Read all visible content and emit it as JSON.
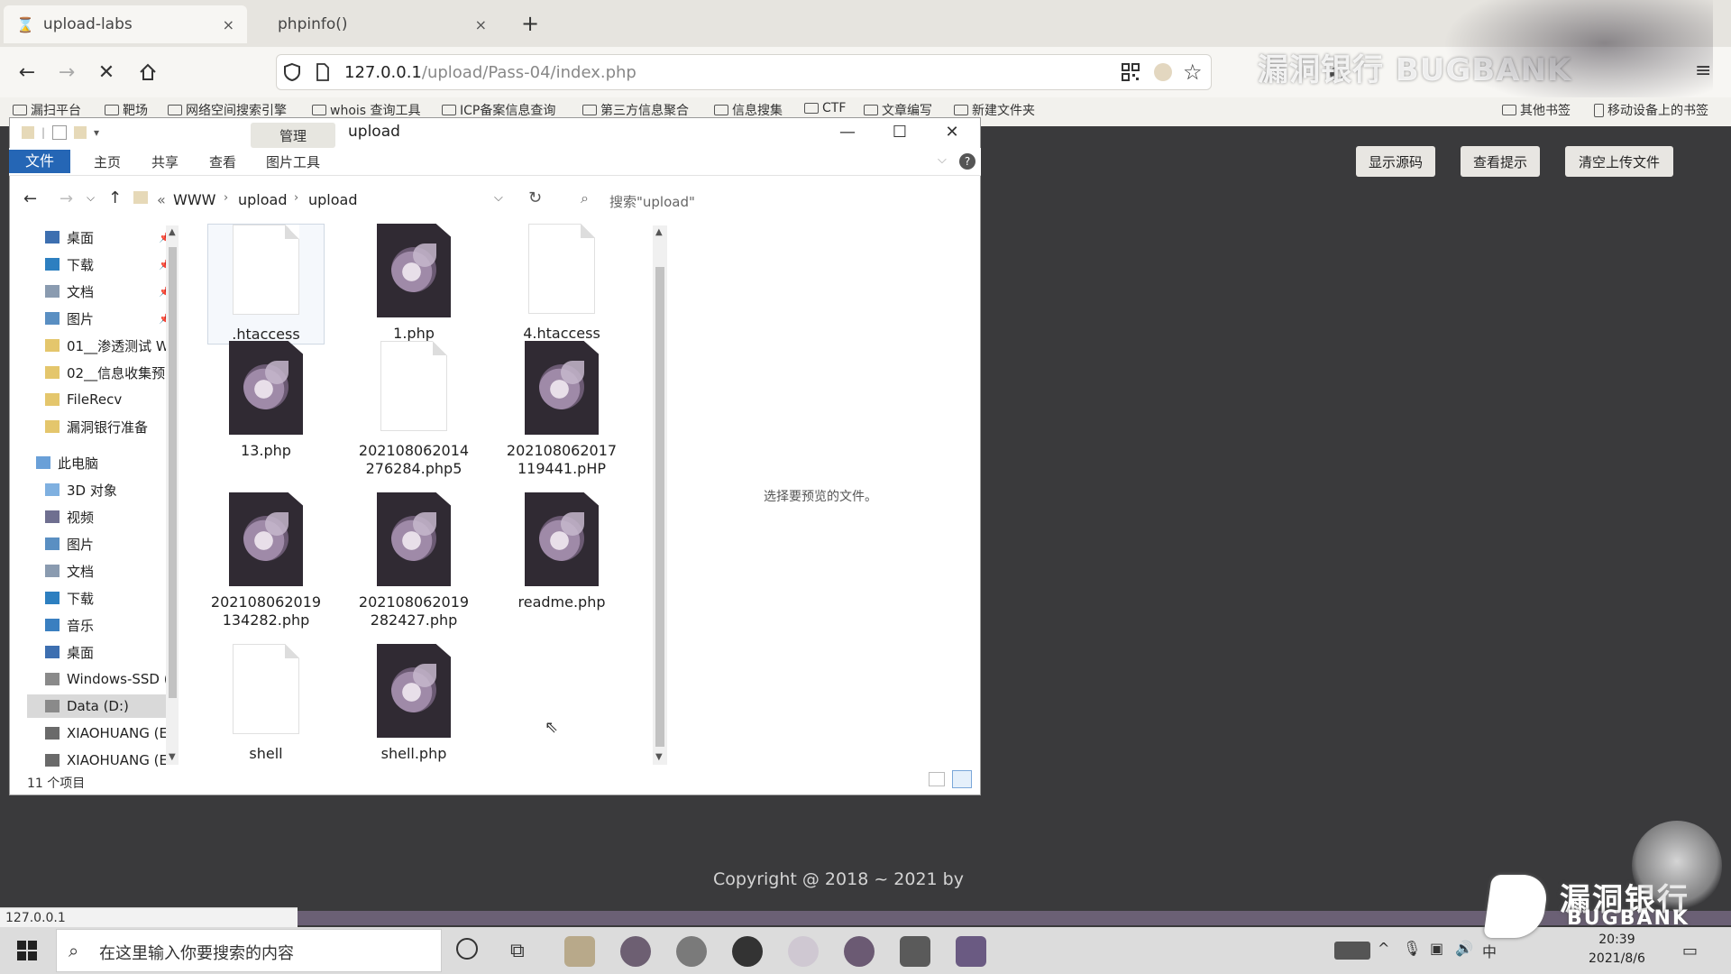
{
  "browser": {
    "tabs": [
      {
        "label": "upload-labs",
        "close": "×"
      },
      {
        "label": "phpinfo()",
        "close": "×"
      }
    ],
    "new_tab": "+",
    "url_host": "127.0.0.1",
    "url_path": "/upload/Pass-04/index.php",
    "bookmarks": [
      "漏扫平台",
      "靶场",
      "网络空间搜索引擎",
      "whois 查询工具",
      "ICP备案信息查询",
      "第三方信息聚合",
      "信息搜集",
      "CTF",
      "文章编写",
      "新建文件夹"
    ],
    "bookmarks_right": [
      "其他书签",
      "移动设备上的书签"
    ],
    "watermark": "漏洞银行 BUGBANK"
  },
  "page": {
    "buttons": [
      "显示源码",
      "查看提示",
      "清空上传文件"
    ],
    "copyright": "Copyright @ 2018 ~ 2021 by",
    "status_url": "127.0.0.1"
  },
  "explorer": {
    "manage_tab": "管理",
    "title": "upload",
    "ribbon_tabs": [
      "文件",
      "主页",
      "共享",
      "查看",
      "图片工具"
    ],
    "breadcrumb_prefix": "«",
    "breadcrumb": [
      "WWW",
      "upload",
      "upload"
    ],
    "search_placeholder": "搜索\"upload\"",
    "nav_items": [
      {
        "label": "桌面",
        "pinned": true,
        "icon": "desktop-icon"
      },
      {
        "label": "下载",
        "pinned": true,
        "icon": "download-icon"
      },
      {
        "label": "文档",
        "pinned": true,
        "icon": "documents-icon"
      },
      {
        "label": "图片",
        "pinned": true,
        "icon": "pictures-icon"
      },
      {
        "label": "01__渗透测试 W",
        "pinned": false,
        "icon": "folder-icon"
      },
      {
        "label": "02__信息收集预",
        "pinned": false,
        "icon": "folder-icon"
      },
      {
        "label": "FileRecv",
        "pinned": false,
        "icon": "folder-icon"
      },
      {
        "label": "漏洞银行准备",
        "pinned": false,
        "icon": "folder-icon"
      },
      {
        "label": "此电脑",
        "pinned": false,
        "icon": "computer-icon"
      },
      {
        "label": "3D 对象",
        "pinned": false,
        "icon": "3d-objects-icon"
      },
      {
        "label": "视频",
        "pinned": false,
        "icon": "videos-icon"
      },
      {
        "label": "图片",
        "pinned": false,
        "icon": "pictures-icon"
      },
      {
        "label": "文档",
        "pinned": false,
        "icon": "documents-icon"
      },
      {
        "label": "下载",
        "pinned": false,
        "icon": "download-icon"
      },
      {
        "label": "音乐",
        "pinned": false,
        "icon": "music-icon"
      },
      {
        "label": "桌面",
        "pinned": false,
        "icon": "desktop-icon"
      },
      {
        "label": "Windows-SSD (",
        "pinned": false,
        "icon": "drive-icon"
      },
      {
        "label": "Data (D:)",
        "pinned": false,
        "icon": "drive-icon",
        "selected": true
      },
      {
        "label": "XIAOHUANG (E",
        "pinned": false,
        "icon": "usb-drive-icon"
      },
      {
        "label": "XIAOHUANG (E:)",
        "pinned": false,
        "icon": "usb-drive-icon"
      }
    ],
    "files": [
      {
        "name": ".htaccess",
        "type": "blank",
        "selected": true
      },
      {
        "name": "1.php",
        "type": "php"
      },
      {
        "name": "4.htaccess",
        "type": "blank"
      },
      {
        "name": "13.php",
        "type": "php"
      },
      {
        "name": "202108062014\n276284.php5",
        "type": "blank"
      },
      {
        "name": "202108062017\n119441.pHP",
        "type": "php"
      },
      {
        "name": "202108062019\n134282.php",
        "type": "php"
      },
      {
        "name": "202108062019\n282427.php",
        "type": "php"
      },
      {
        "name": "readme.php",
        "type": "php"
      },
      {
        "name": "shell",
        "type": "blank"
      },
      {
        "name": "shell.php",
        "type": "php"
      }
    ],
    "preview_text": "选择要预览的文件。",
    "item_count": "11 个项目"
  },
  "taskbar": {
    "search_placeholder": "在这里输入你要搜索的内容",
    "time": "20:39",
    "date": "2021/8/6"
  },
  "brand": {
    "line1": "漏洞银行",
    "line2": "BUGBANK"
  }
}
